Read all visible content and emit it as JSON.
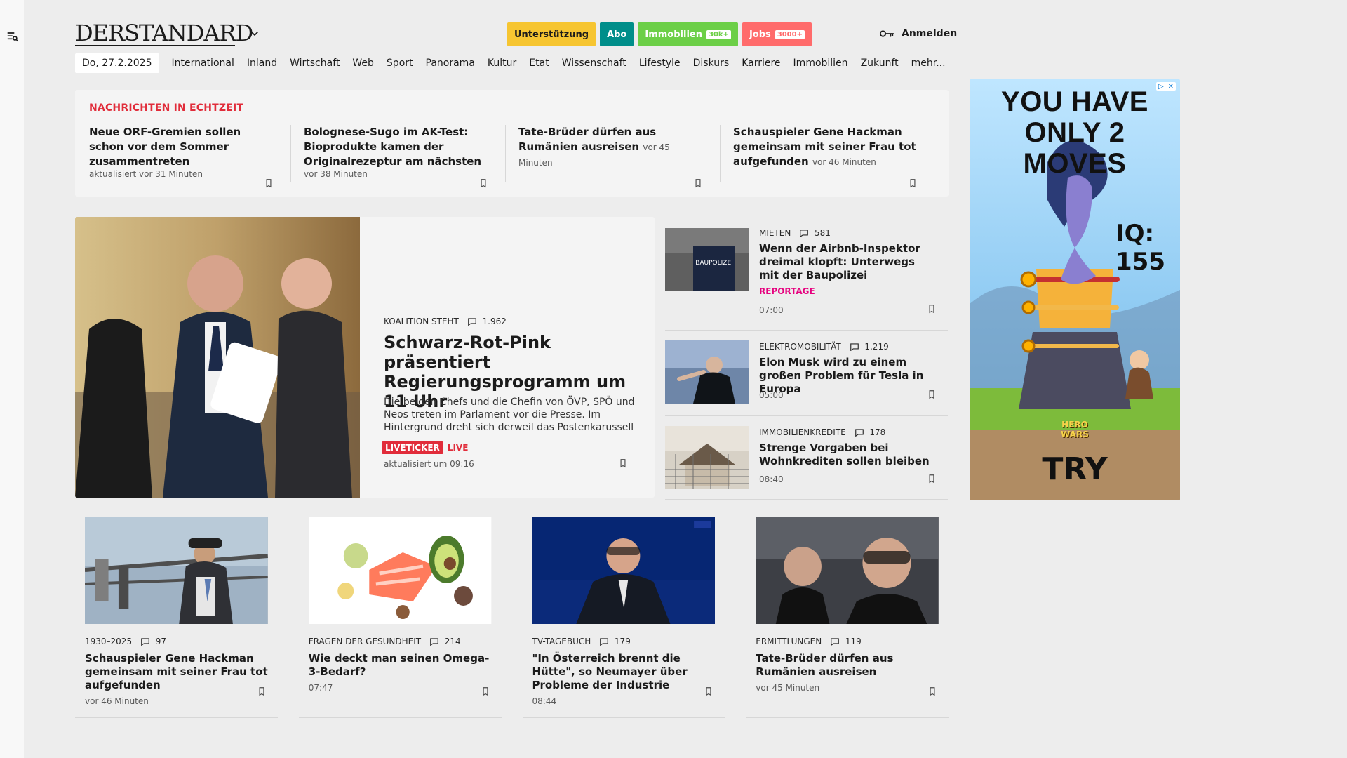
{
  "header": {
    "logo": "DERSTANDARD",
    "promo": {
      "unterstuetzung": "Unterstützung",
      "abo": "Abo",
      "immobilien": "Immobilien",
      "immobilien_badge": "30k+",
      "jobs": "Jobs",
      "jobs_badge": "3000+"
    },
    "login": "Anmelden"
  },
  "nav": {
    "date": "Do, 27.2.2025",
    "items": [
      "International",
      "Inland",
      "Wirtschaft",
      "Web",
      "Sport",
      "Panorama",
      "Kultur",
      "Etat",
      "Wissenschaft",
      "Lifestyle",
      "Diskurs",
      "Karriere",
      "Immobilien",
      "Zukunft",
      "mehr..."
    ]
  },
  "realtime": {
    "header": "NACHRICHTEN IN ECHTZEIT",
    "items": [
      {
        "title": "Neue ORF-Gremien sollen schon vor dem Sommer zusammentreten",
        "time": "aktualisiert vor 31 Minuten"
      },
      {
        "title": "Bolognese-Sugo im AK-Test: Bioprodukte kamen der Originalrezeptur am nächsten",
        "time": "vor 38 Minuten"
      },
      {
        "title": "Tate-Brüder dürfen aus Rumänien ausreisen",
        "time": "vor 45 Minuten"
      },
      {
        "title": "Schauspieler Gene Hackman gemeinsam mit seiner Frau tot aufgefunden",
        "time": "vor 46 Minuten"
      }
    ]
  },
  "hero": {
    "kicker": "KOALITION STEHT",
    "comments": "1.962",
    "title": "Schwarz-Rot-Pink präsentiert Regierungsprogramm um 11 Uhr",
    "lead": "Die beiden Chefs und die Chefin von ÖVP, SPÖ und Neos treten im Parlament vor die Presse. Im Hintergrund dreht sich derweil das Postenkarussell",
    "badge": "LIVETICKER",
    "live": "LIVE",
    "time": "aktualisiert um 09:16"
  },
  "right_list": [
    {
      "kicker": "MIETEN",
      "comments": "581",
      "title": "Wenn der Airbnb-Inspektor dreimal klopft: Unterwegs mit der Baupolizei",
      "extra": "REPORTAGE",
      "time": "07:00"
    },
    {
      "kicker": "ELEKTROMOBILITÄT",
      "comments": "1.219",
      "title": "Elon Musk wird zu einem großen Problem für Tesla in Europa",
      "time": "05:00"
    },
    {
      "kicker": "IMMOBILIENKREDITE",
      "comments": "178",
      "title": "Strenge Vorgaben bei Wohnkrediten sollen bleiben",
      "time": "08:40"
    }
  ],
  "ad": {
    "title_line1": "YOU HAVE",
    "title_line2": "ONLY 2 MOVES",
    "iq": "IQ: 155",
    "brand": "HERO WARS",
    "cta": "TRY"
  },
  "cards": [
    {
      "kicker": "1930–2025",
      "comments": "97",
      "title": "Schauspieler Gene Hackman gemeinsam mit seiner Frau tot aufgefunden",
      "time": "vor 46 Minuten"
    },
    {
      "kicker": "FRAGEN DER GESUNDHEIT",
      "comments": "214",
      "title": "Wie deckt man seinen Omega-3-Bedarf?",
      "time": "07:47"
    },
    {
      "kicker": "TV-TAGEBUCH",
      "comments": "179",
      "title": "\"In Österreich brennt die Hütte\", so Neumayer über Probleme der Industrie",
      "time": "08:44"
    },
    {
      "kicker": "ERMITTLUNGEN",
      "comments": "119",
      "title": "Tate-Brüder dürfen aus Rumänien ausreisen",
      "time": "vor 45 Minuten"
    }
  ],
  "colors": {
    "accent_red": "#e12c3a",
    "pink": "#e6007e",
    "abo_teal": "#008e8a",
    "immo_green": "#6ccf47",
    "jobs_red": "#ff6b6b",
    "support_yellow": "#f6c531"
  }
}
